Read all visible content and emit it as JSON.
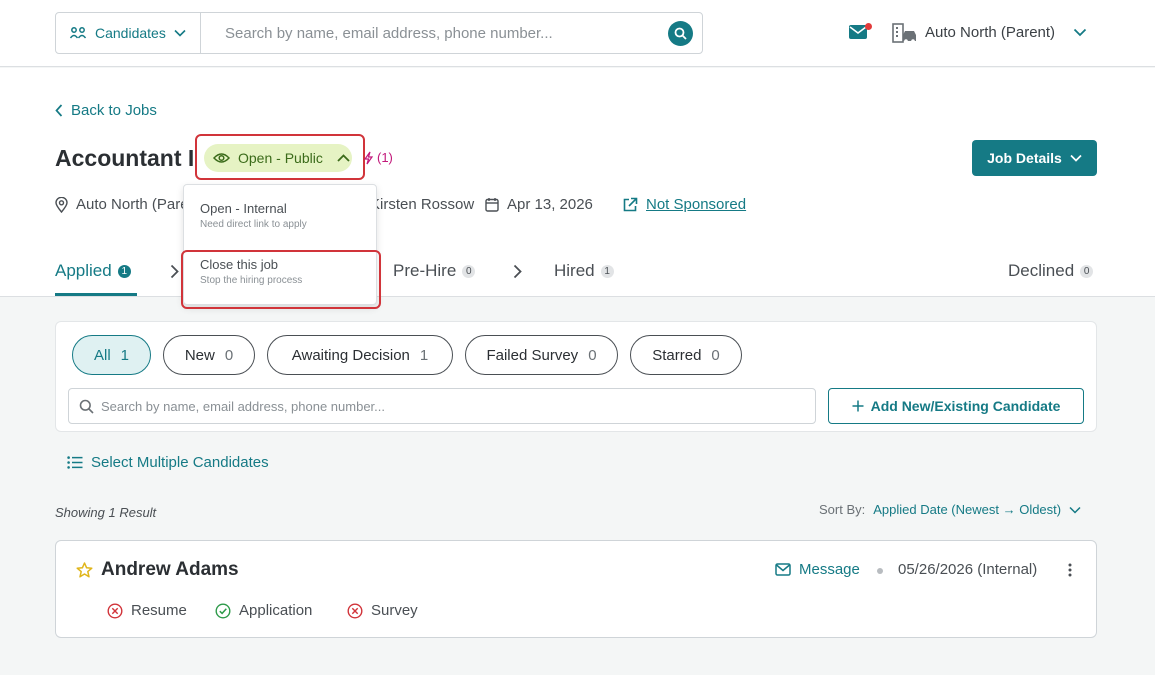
{
  "topbar": {
    "scope_label": "Candidates",
    "search_placeholder": "Search by name, email address, phone number...",
    "org_name": "Auto North (Parent)"
  },
  "job": {
    "back_label": "Back to Jobs",
    "title": "Accountant I",
    "status_label": "Open - Public",
    "boost_count": "(1)",
    "details_label": "Job Details",
    "location": "Auto North (Parent)",
    "recruiter": "Kirsten Rossow",
    "date": "Apr 13, 2026",
    "sponsor_label": "Not Sponsored"
  },
  "status_menu": {
    "items": [
      {
        "title": "Open - Internal",
        "subtitle": "Need direct link to apply"
      },
      {
        "title": "Close this job",
        "subtitle": "Stop the hiring process"
      }
    ]
  },
  "stages": [
    {
      "label": "Applied",
      "count": "1"
    },
    {
      "label": "Pre-Hire",
      "count": "0"
    },
    {
      "label": "Hired",
      "count": "1"
    },
    {
      "label": "Declined",
      "count": "0"
    }
  ],
  "filters": [
    {
      "label": "All",
      "count": "1"
    },
    {
      "label": "New",
      "count": "0"
    },
    {
      "label": "Awaiting Decision",
      "count": "1"
    },
    {
      "label": "Failed Survey",
      "count": "0"
    },
    {
      "label": "Starred",
      "count": "0"
    }
  ],
  "list": {
    "search_placeholder": "Search by name, email address, phone number...",
    "add_label": "Add New/Existing Candidate",
    "select_multiple_label": "Select Multiple Candidates",
    "showing_label": "Showing 1 Result",
    "sort_label": "Sort By:",
    "sort_value": "Applied Date (Newest → Oldest)"
  },
  "candidate": {
    "name": "Andrew Adams",
    "message_label": "Message",
    "applied_info": "05/26/2026 (Internal)",
    "requirements": [
      {
        "label": "Resume",
        "status": "failed"
      },
      {
        "label": "Application",
        "status": "passed"
      },
      {
        "label": "Survey",
        "status": "failed"
      }
    ]
  },
  "colors": {
    "accent": "#157a85",
    "highlight_red": "#d1343a",
    "status_green_bg": "#e6f3c4",
    "boost_magenta": "#c2187a"
  }
}
